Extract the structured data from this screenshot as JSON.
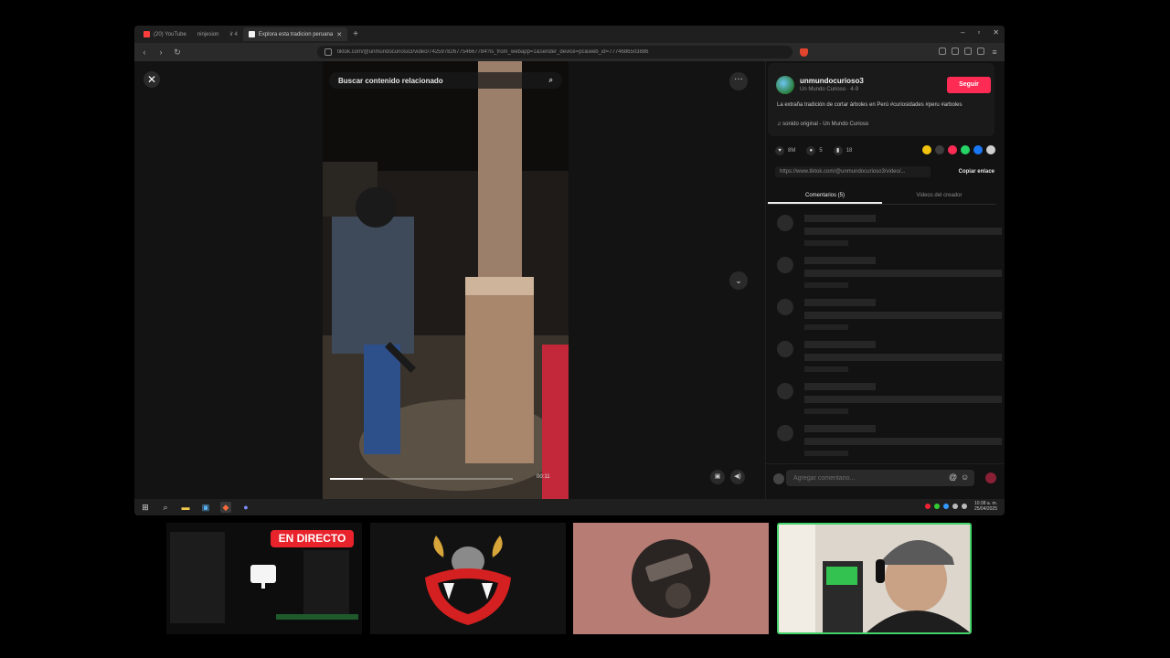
{
  "browser": {
    "tabs": [
      {
        "label": "(20) YouTube",
        "active": false,
        "favicon_color": "#ff3d3d"
      },
      {
        "label": "ninjesion",
        "active": false,
        "favicon_color": "#5a5a5a"
      },
      {
        "label": "ir 4",
        "active": false,
        "favicon_color": "#5a5a5a"
      },
      {
        "label": "Explora esta tradicion peruana",
        "active": true,
        "favicon_color": "#f3f3f3"
      }
    ],
    "url": "tiktok.com/@unmundocurioso3/video/7425978267754667784?is_from_webapp=1&sender_device=pc&web_id=7774686503886"
  },
  "video": {
    "search_placeholder": "Buscar contenido relacionado",
    "time": "00:11",
    "progress_fraction": 0.18
  },
  "side": {
    "username": "unmundocurioso3",
    "subline": "Un Mundo Curioso · 4-9",
    "follow_label": "Seguir",
    "caption": "La extraña tradición de cortar árboles en Perú #curiosidades #peru #arboles",
    "sound": "♫ sonido original - Un Mundo Curioso",
    "stats": {
      "likes": "8M",
      "comments": "5",
      "saves": "18"
    },
    "share_url": "https://www.tiktok.com/@unmundocurioso3/video/...",
    "copy_link_label": "Copiar enlace",
    "tabs": [
      "Comentarios (5)",
      "Videos del creador"
    ],
    "comment_placeholder": "Agregar comentario...",
    "skeleton_rows": 6
  },
  "taskbar": {
    "clock_time": "10:38 a. m.",
    "clock_date": "25/04/2025"
  },
  "overlay": {
    "live_label": "EN DIRECTO"
  },
  "colors": {
    "accent": "#fe2c55",
    "live": "#e8232c",
    "cam_border": "#44d36a"
  }
}
